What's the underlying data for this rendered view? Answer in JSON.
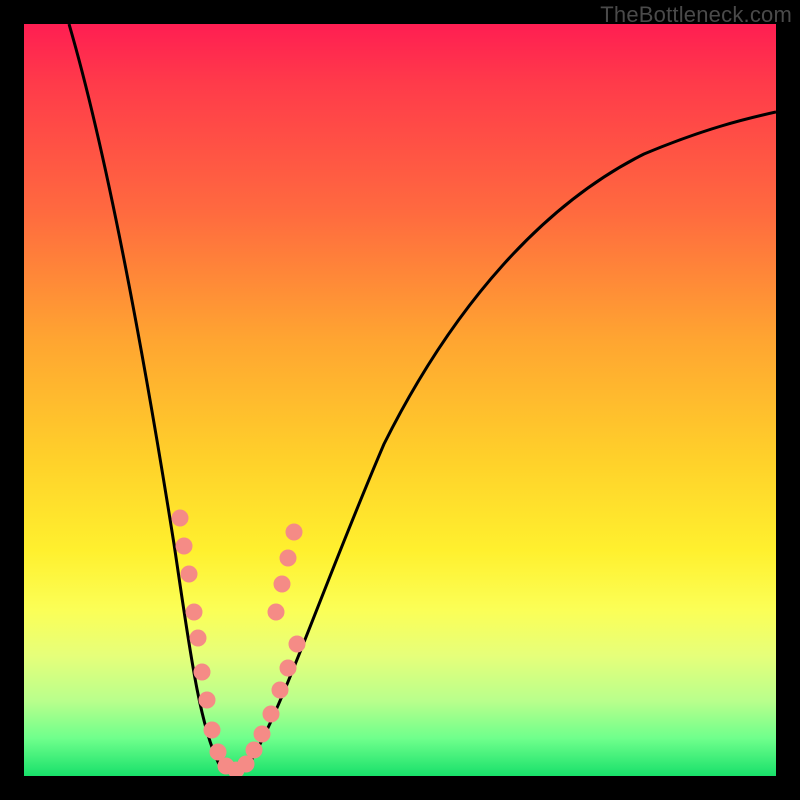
{
  "watermark": "TheBottleneck.com",
  "chart_data": {
    "type": "line",
    "title": "",
    "xlabel": "",
    "ylabel": "",
    "xlim": [
      0,
      100
    ],
    "ylim": [
      0,
      100
    ],
    "grid": false,
    "legend": false,
    "description": "Bottleneck severity curve. Y axis represents bottleneck percentage (high = red = bad, low = green = good). Curve drops sharply to a minimum near x≈25 then rises asymptotically. Pink dot markers cluster along both flanks of the valley near the minimum.",
    "series": [
      {
        "name": "bottleneck-curve",
        "x": [
          6,
          8,
          10,
          12,
          14,
          16,
          18,
          20,
          22,
          24,
          26,
          28,
          30,
          32,
          35,
          40,
          45,
          50,
          55,
          60,
          65,
          70,
          75,
          80,
          85,
          90,
          95,
          100
        ],
        "y": [
          100,
          90,
          80,
          70,
          60,
          50,
          40,
          30,
          20,
          8,
          2,
          2,
          8,
          15,
          25,
          38,
          48,
          56,
          62,
          67,
          71,
          74,
          77,
          79,
          81,
          82.5,
          84,
          85
        ]
      },
      {
        "name": "marker-dots",
        "x": [
          18.5,
          19.3,
          20.0,
          20.8,
          21.5,
          22.2,
          23.0,
          23.8,
          24.6,
          25.4,
          26.2,
          27.0,
          27.8,
          28.6,
          29.4,
          30.2,
          31.0,
          31.8,
          32.6,
          33.4
        ],
        "y": [
          35,
          30,
          26,
          22,
          18,
          14,
          10,
          6,
          3,
          1.5,
          1.5,
          3,
          6,
          9,
          13,
          17,
          21,
          25,
          29,
          33
        ]
      }
    ]
  }
}
